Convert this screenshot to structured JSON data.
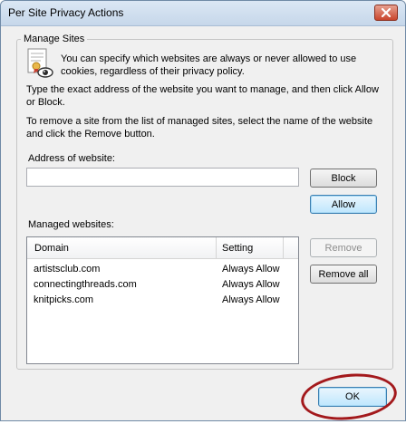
{
  "window": {
    "title": "Per Site Privacy Actions"
  },
  "group": {
    "label": "Manage Sites",
    "intro": "You can specify which websites are always or never allowed to use cookies, regardless of their privacy policy.",
    "instruction1": "Type the exact address of the website you want to manage, and then click Allow or Block.",
    "instruction2": "To remove a site from the list of managed sites, select the name of the website and click the Remove button."
  },
  "address": {
    "label": "Address of website:",
    "value": ""
  },
  "buttons": {
    "block": "Block",
    "allow": "Allow",
    "remove": "Remove",
    "remove_all": "Remove all",
    "ok": "OK"
  },
  "managed": {
    "label": "Managed websites:",
    "columns": [
      "Domain",
      "Setting"
    ],
    "rows": [
      {
        "domain": "artistsclub.com",
        "setting": "Always Allow"
      },
      {
        "domain": "connectingthreads.com",
        "setting": "Always Allow"
      },
      {
        "domain": "knitpicks.com",
        "setting": "Always Allow"
      }
    ]
  },
  "icons": {
    "close": "close-icon",
    "privacy": "privacy-certificate-icon"
  },
  "colors": {
    "annotation_ring": "#a3191c",
    "titlebar": "#c6d7ea",
    "close_button": "#c9452c"
  }
}
